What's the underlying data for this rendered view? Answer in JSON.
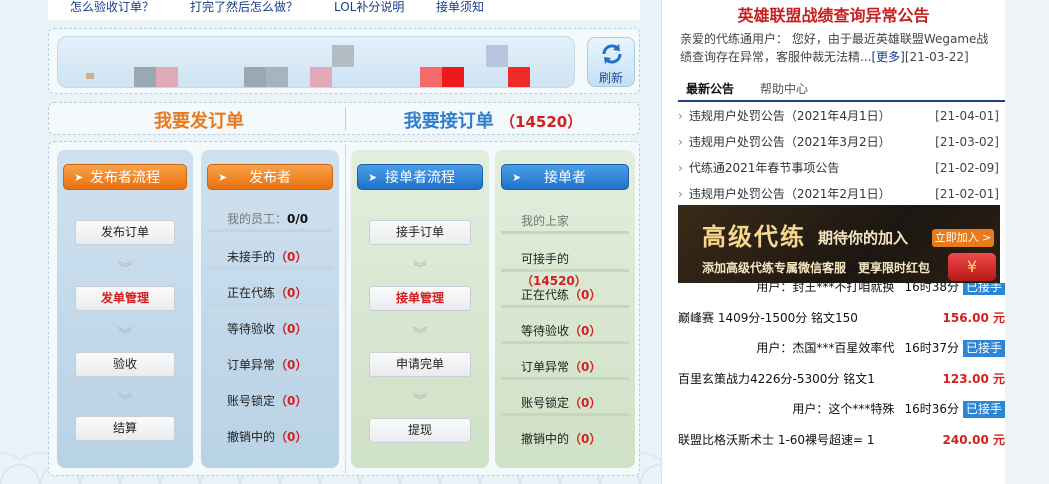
{
  "top_links": [
    "怎么验收订单？",
    "打完了然后怎么做？",
    "LOL补分说明",
    "接单须知"
  ],
  "refresh": {
    "label": "刷新"
  },
  "section_titles": {
    "post": "我要发订单",
    "take": "我要接订单",
    "take_count": "14520"
  },
  "publisher_flow": {
    "header": "发布者流程",
    "steps": [
      "发布订单",
      "发单管理",
      "验收",
      "结算"
    ]
  },
  "publisher": {
    "header": "发布者",
    "staff_label": "我的员工：",
    "staff_value": "0/0",
    "stats": [
      {
        "label": "未接手的",
        "value": "0"
      },
      {
        "label": "正在代练",
        "value": "0"
      },
      {
        "label": "等待验收",
        "value": "0"
      },
      {
        "label": "订单异常",
        "value": "0"
      },
      {
        "label": "账号锁定",
        "value": "0"
      },
      {
        "label": "撤销中的",
        "value": "0"
      }
    ]
  },
  "taker_flow": {
    "header": "接单者流程",
    "steps": [
      "接手订单",
      "接单管理",
      "申请完单",
      "提现"
    ]
  },
  "taker": {
    "header": "接单者",
    "boss_label": "我的上家",
    "stats": [
      {
        "label": "可接手的",
        "value": "14520"
      },
      {
        "label": "正在代练",
        "value": "0"
      },
      {
        "label": "等待验收",
        "value": "0"
      },
      {
        "label": "订单异常",
        "value": "0"
      },
      {
        "label": "账号锁定",
        "value": "0"
      },
      {
        "label": "撤销中的",
        "value": "0"
      }
    ]
  },
  "notice": {
    "title": "英雄联盟战绩查询异常公告",
    "text": "亲爱的代练通用户： 您好，由于最近英雄联盟Wegame战绩查询存在异常，客服仲裁无法精...",
    "more": "[更多]",
    "date": "[21-03-22]"
  },
  "tabs": [
    "最新公告",
    "帮助中心"
  ],
  "news": [
    {
      "title": "违规用户处罚公告（2021年4月1日）",
      "date": "[21-04-01]"
    },
    {
      "title": "违规用户处罚公告（2021年3月2日）",
      "date": "[21-03-02]"
    },
    {
      "title": "代练通2021年春节事项公告",
      "date": "[21-02-09]"
    },
    {
      "title": "违规用户处罚公告（2021年2月1日）",
      "date": "[21-02-01]"
    }
  ],
  "ad": {
    "big": "高级代练",
    "sub": "期待你的加入",
    "button": "立即加入 >",
    "line": "添加高级代练专属微信客服　更享限时红包"
  },
  "orders": [
    {
      "kind": "user",
      "who": "用户：封王***不打咱就换",
      "time": "16时38分",
      "status": "已接手"
    },
    {
      "kind": "order",
      "title": "巅峰赛 1409分-1500分 铭文150",
      "price": "156.00 元"
    },
    {
      "kind": "user",
      "who": "用户：杰国***百星效率代",
      "time": "16时37分",
      "status": "已接手"
    },
    {
      "kind": "order",
      "title": "百里玄策战力4226分-5300分 铭文1",
      "price": "123.00 元"
    },
    {
      "kind": "user",
      "who": "用户：这个***特殊",
      "time": "16时36分",
      "status": "已接手"
    },
    {
      "kind": "order",
      "title": "联盟比格沃斯术士 1-60裸号超速= 1",
      "price": "240.00 元"
    }
  ],
  "colors": {
    "orange": "#e8700e",
    "blue": "#1e70c8",
    "red": "#d31f1f",
    "navy": "#1e3f86"
  }
}
